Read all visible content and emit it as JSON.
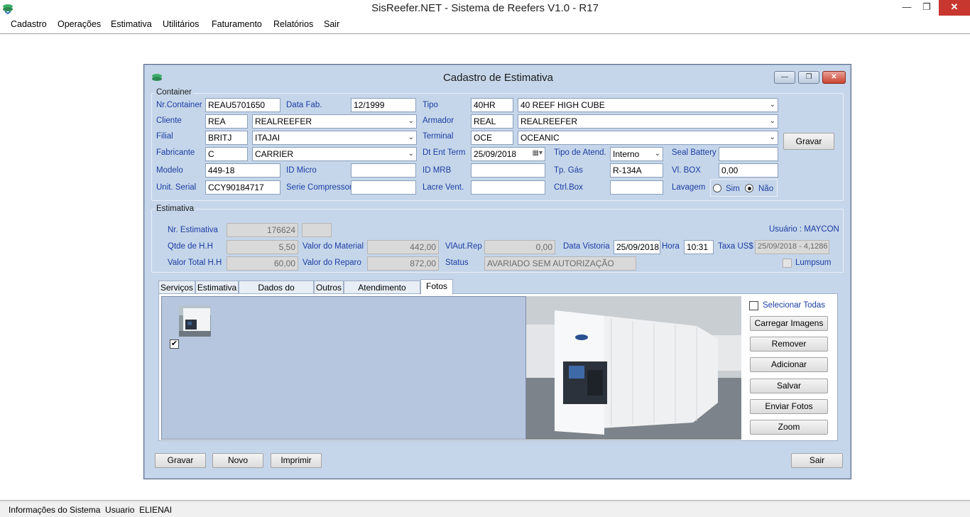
{
  "window": {
    "title": "SisReefer.NET - Sistema de Reefers V1.0 - R17"
  },
  "menu": [
    "Cadastro",
    "Operações",
    "Estimativa",
    "Utilitários",
    "Faturamento",
    "Relatórios",
    "Sair"
  ],
  "status_bar": {
    "text": "Informações do Sistema  Usuario  ELIENAI"
  },
  "dialog": {
    "title": "Cadastro de Estimativa",
    "container_group": {
      "label": "Container",
      "nr_container": {
        "label": "Nr.Container",
        "value": "REAU5701650"
      },
      "data_fab": {
        "label": "Data Fab.",
        "value": "12/1999"
      },
      "tipo": {
        "label": "Tipo",
        "code": "40HR",
        "desc": "40 REEF HIGH CUBE"
      },
      "cliente": {
        "label": "Cliente",
        "code": "REA",
        "desc": "REALREEFER"
      },
      "armador": {
        "label": "Armador",
        "code": "REAL",
        "desc": "REALREEFER"
      },
      "filial": {
        "label": "Filial",
        "code": "BRITJ",
        "desc": "ITAJAI"
      },
      "terminal": {
        "label": "Terminal",
        "code": "OCE",
        "desc": "OCEANIC"
      },
      "fabricante": {
        "label": "Fabricante",
        "code": "C",
        "desc": "CARRIER"
      },
      "dt_ent_term": {
        "label": "Dt Ent Term",
        "value": "25/09/2018"
      },
      "tipo_atend": {
        "label": "Tipo de Atend.",
        "value": "Interno"
      },
      "seal_battery": {
        "label": "Seal Battery",
        "value": ""
      },
      "modelo": {
        "label": "Modelo",
        "value": "449-18"
      },
      "id_micro": {
        "label": "ID Micro",
        "value": ""
      },
      "id_mrb": {
        "label": "ID MRB",
        "value": ""
      },
      "tp_gas": {
        "label": "Tp. Gás",
        "value": "R-134A"
      },
      "vl_box": {
        "label": "Vl. BOX",
        "value": "0,00"
      },
      "unit_serial": {
        "label": "Unit. Serial",
        "value": "CCY90184717"
      },
      "serie_compressor": {
        "label": "Serie Compressor",
        "value": ""
      },
      "lacre_vent": {
        "label": "Lacre Vent.",
        "value": ""
      },
      "ctrl_box": {
        "label": "Ctrl.Box",
        "value": ""
      },
      "lavagem": {
        "label": "Lavagem",
        "sim": "Sim",
        "nao": "Não",
        "selected": "Não"
      },
      "gravar_label": "Gravar"
    },
    "estimativa_group": {
      "label": "Estimativa",
      "nr_estimativa": {
        "label": "Nr. Estimativa",
        "value": "176624",
        "extra": ""
      },
      "usuario": "Usuário : MAYCON",
      "qtde_hh": {
        "label": "Qtde de H.H",
        "value": "5,50"
      },
      "valor_material": {
        "label": "Valor do Material",
        "value": "442,00"
      },
      "vlaut_rep": {
        "label": "VlAut.Rep",
        "value": "0,00"
      },
      "data_vistoria": {
        "label": "Data Vistoria",
        "value": "25/09/2018"
      },
      "hora": {
        "label": "Hora",
        "value": "10:31"
      },
      "taxa_us": {
        "label": "Taxa US$",
        "value": "25/09/2018 - 4,1286"
      },
      "valor_total_hh": {
        "label": "Valor Total H.H",
        "value": "60,00"
      },
      "valor_reparo": {
        "label": "Valor do Reparo",
        "value": "872,00"
      },
      "status": {
        "label": "Status",
        "value": "AVARIADO SEM AUTORIZAÇÃO"
      },
      "lumpsum": "Lumpsum"
    },
    "tabs": [
      "Serviços",
      "Estimativa",
      "Dados do Container",
      "Outros",
      "Atendimento Externo",
      "Fotos"
    ],
    "active_tab": "Fotos",
    "fotos": {
      "selecionar_todas": "Selecionar Todas",
      "buttons": [
        "Carregar Imagens",
        "Remover",
        "Adicionar",
        "Salvar",
        "Enviar Fotos",
        "Zoom"
      ]
    },
    "bottom": {
      "gravar": "Gravar",
      "novo": "Novo",
      "imprimir": "Imprimir",
      "sair": "Sair"
    }
  }
}
